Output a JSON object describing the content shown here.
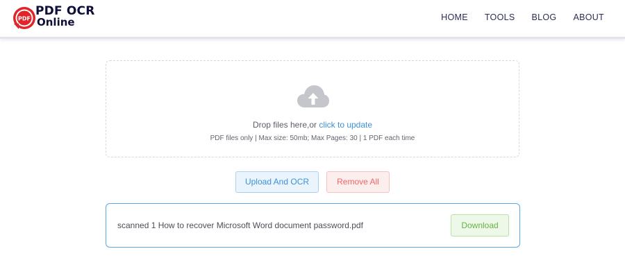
{
  "header": {
    "logo": {
      "badge_text": "PDF",
      "line1": "PDF OCR",
      "line2": "Online"
    },
    "nav": [
      {
        "label": "HOME"
      },
      {
        "label": "TOOLS"
      },
      {
        "label": "BLOG"
      },
      {
        "label": "ABOUT"
      }
    ]
  },
  "upload": {
    "icon": "cloud-upload-icon",
    "prompt": "Drop files here,or ",
    "link_label": "click to update",
    "hint": "PDF files only | Max size: 50mb; Max Pages: 30 | 1 PDF each time"
  },
  "actions": {
    "upload_label": "Upload And OCR",
    "remove_label": "Remove All"
  },
  "files": [
    {
      "name": "scanned 1 How to recover Microsoft Word document password.pdf",
      "download_label": "Download"
    }
  ],
  "colors": {
    "brand_red": "#e0242a",
    "brand_navy": "#0f0f3a",
    "link_blue": "#3d8fd8",
    "danger_red": "#ef6666",
    "success_green": "#63b443",
    "icon_gray": "#c4c6cc"
  }
}
